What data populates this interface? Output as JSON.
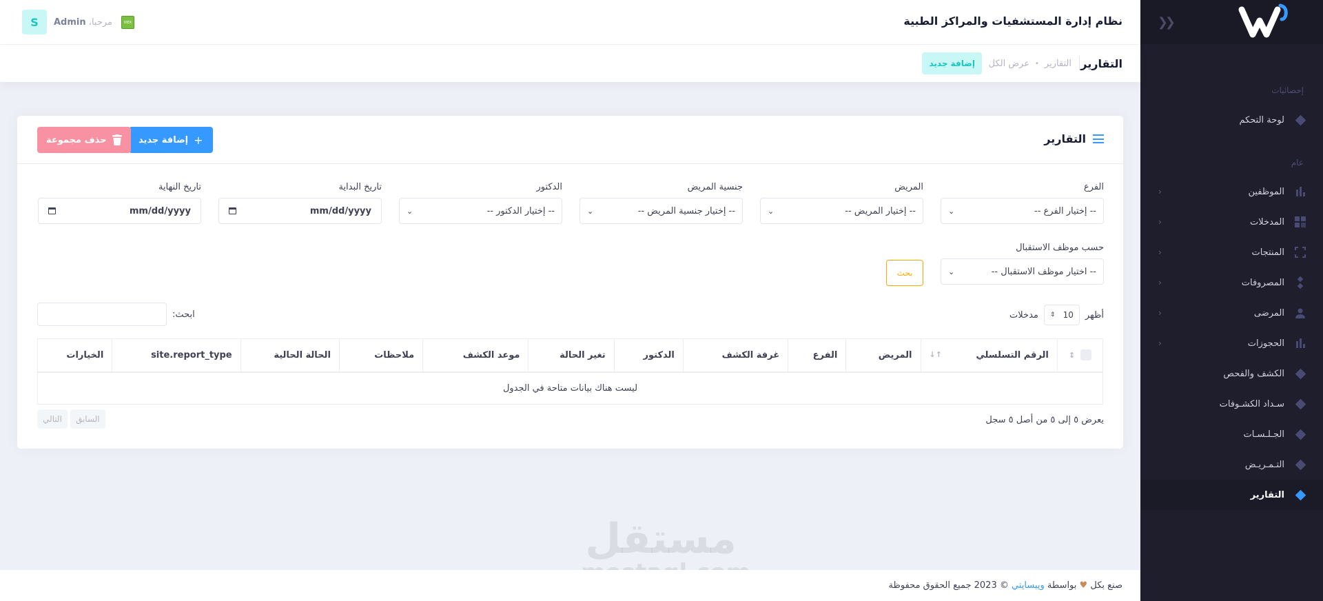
{
  "header": {
    "app_title": "نظام إدارة المستشفيات والمراكز الطبية",
    "greeting": "مرحبا،",
    "user_name": "Admin",
    "avatar_letter": "S",
    "flag_label": "VIEX"
  },
  "subheader": {
    "title": "التقارير",
    "breadcrumb_1": "التقارير",
    "breadcrumb_2": "عرض الكل",
    "add_new_label": "إضافة جديد"
  },
  "sidebar": {
    "section_1": "إحصائيات",
    "section_2": "عام",
    "items": [
      {
        "label": "لوحة التحكم",
        "icon": "diamond-icon"
      },
      {
        "label": "الموظفين",
        "icon": "bar-chart-icon"
      },
      {
        "label": "المدخلات",
        "icon": "grid-icon"
      },
      {
        "label": "المنتجات",
        "icon": "expand-icon"
      },
      {
        "label": "المصروفات",
        "icon": "diamonds-icon"
      },
      {
        "label": "المرضى",
        "icon": "user-icon"
      },
      {
        "label": "الحجوزات",
        "icon": "bar-chart-icon"
      },
      {
        "label": "الكشف والفحص",
        "icon": "diamond-icon"
      },
      {
        "label": "سـداد الكشـوفات",
        "icon": "diamond-icon"
      },
      {
        "label": "الجـلـسـات",
        "icon": "diamond-icon"
      },
      {
        "label": "التـمـريـض",
        "icon": "diamond-icon"
      },
      {
        "label": "التقارير",
        "icon": "diamond-icon"
      }
    ]
  },
  "card": {
    "title": "التقارير",
    "add_button": "إضافة جديد",
    "delete_button": "حذف مجموعة"
  },
  "filters": {
    "branch_label": "الفرع",
    "branch_placeholder": "-- إختيار الفرع --",
    "patient_label": "المريض",
    "patient_placeholder": "-- إختيار المريض --",
    "nationality_label": "جنسية المريض",
    "nationality_placeholder": "-- إختيار جنسية المريض --",
    "doctor_label": "الدكتور",
    "doctor_placeholder": "-- إختيار الدكتور --",
    "start_label": "تاريخ البداية",
    "start_value": "mm/dd/yyyy",
    "end_label": "تاريخ النهاية",
    "end_value": "mm/dd/yyyy",
    "reception_label": "حسب موظف الاستقبال",
    "reception_placeholder": "-- اختيار موظف الاستقبال --",
    "search_button": "بحث"
  },
  "table": {
    "show_label": "أظهر",
    "entries_label": "مدخلات",
    "page_length": "10",
    "search_label": "ابحث:",
    "columns": [
      "الرقم التسلسلي",
      "المريض",
      "الفرع",
      "غرفة الكشف",
      "الدكتور",
      "تغير الحالة",
      "موعد الكشف",
      "ملاحظات",
      "الحالة الحالية",
      "site.report_type",
      "الخيارات"
    ],
    "empty_message": "ليست هناك بيانات متاحة في الجدول",
    "info": "يعرض ٥ إلى ٥ من أصل ٥ سجل",
    "prev": "السابق",
    "next": "التالي"
  },
  "watermark": {
    "line1": "مستقل",
    "line2": "mostaql.com"
  },
  "footer": {
    "made_with": "صنع بكل",
    "by": "بواسطة",
    "company": "ويبسايتي",
    "copyright": "© 2023 جميع الحقوق محفوظة"
  },
  "colors": {
    "primary": "#3699ff",
    "danger_light": "#f891a1",
    "warning": "#ffa800",
    "sidebar_bg": "#1e1e2d",
    "info_light": "#c9f7f5"
  }
}
